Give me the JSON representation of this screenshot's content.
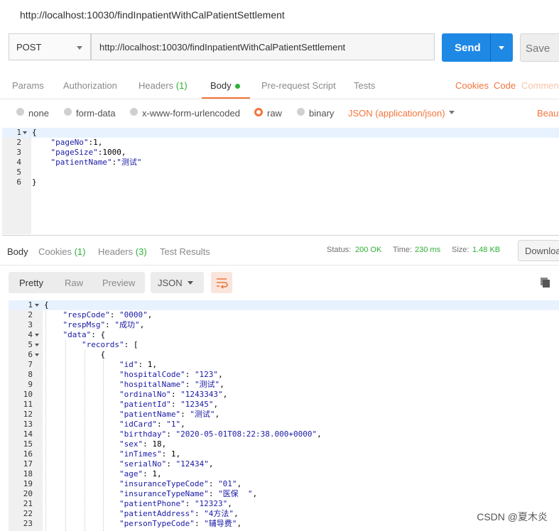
{
  "window": {
    "title": "http://localhost:10030/findInpatientWithCalPatientSettlement"
  },
  "request": {
    "method": "POST",
    "url": "http://localhost:10030/findInpatientWithCalPatientSettlement",
    "send_label": "Send",
    "save_label": "Save",
    "tabs": [
      {
        "label": "Params"
      },
      {
        "label": "Authorization"
      },
      {
        "label": "Headers",
        "count": "(1)"
      },
      {
        "label": "Body"
      },
      {
        "label": "Pre-request Script"
      },
      {
        "label": "Tests"
      }
    ],
    "right_links": {
      "cookies": "Cookies",
      "code": "Code",
      "comments": "Comments"
    },
    "body_types": [
      "none",
      "form-data",
      "x-www-form-urlencoded",
      "raw",
      "binary"
    ],
    "selected_body_type": "raw",
    "content_type": "JSON (application/json)",
    "beautify": "Beautify",
    "editor_lines": [
      {
        "n": "1",
        "t": "{"
      },
      {
        "n": "2",
        "t": "    \"pageNo\":1,"
      },
      {
        "n": "3",
        "t": "    \"pageSize\":1000,"
      },
      {
        "n": "4",
        "t": "    \"patientName\":\"测试\""
      },
      {
        "n": "5",
        "t": ""
      },
      {
        "n": "6",
        "t": "}"
      }
    ]
  },
  "response": {
    "tabs": [
      {
        "label": "Body"
      },
      {
        "label": "Cookies",
        "count": "(1)"
      },
      {
        "label": "Headers",
        "count": "(3)"
      },
      {
        "label": "Test Results"
      }
    ],
    "status_label": "Status:",
    "status_value": "200 OK",
    "time_label": "Time:",
    "time_value": "230 ms",
    "size_label": "Size:",
    "size_value": "1.48 KB",
    "download_label": "Download",
    "view_modes": [
      "Pretty",
      "Raw",
      "Preview"
    ],
    "format": "JSON",
    "lines": [
      {
        "n": "1",
        "t": "{",
        "fold": true
      },
      {
        "n": "2",
        "t": "    \"respCode\": \"0000\","
      },
      {
        "n": "3",
        "t": "    \"respMsg\": \"成功\","
      },
      {
        "n": "4",
        "t": "    \"data\": {",
        "fold": true
      },
      {
        "n": "5",
        "t": "        \"records\": [",
        "fold": true
      },
      {
        "n": "6",
        "t": "            {",
        "fold": true
      },
      {
        "n": "7",
        "t": "                \"id\": 1,"
      },
      {
        "n": "8",
        "t": "                \"hospitalCode\": \"123\","
      },
      {
        "n": "9",
        "t": "                \"hospitalName\": \"测试\","
      },
      {
        "n": "10",
        "t": "                \"ordinalNo\": \"1243343\","
      },
      {
        "n": "11",
        "t": "                \"patientId\": \"12345\","
      },
      {
        "n": "12",
        "t": "                \"patientName\": \"测试\","
      },
      {
        "n": "13",
        "t": "                \"idCard\": \"1\","
      },
      {
        "n": "14",
        "t": "                \"birthday\": \"2020-05-01T08:22:38.000+0000\","
      },
      {
        "n": "15",
        "t": "                \"sex\": 18,"
      },
      {
        "n": "16",
        "t": "                \"inTimes\": 1,"
      },
      {
        "n": "17",
        "t": "                \"serialNo\": \"12434\","
      },
      {
        "n": "18",
        "t": "                \"age\": 1,"
      },
      {
        "n": "19",
        "t": "                \"insuranceTypeCode\": \"01\","
      },
      {
        "n": "20",
        "t": "                \"insuranceTypeName\": \"医保  \","
      },
      {
        "n": "21",
        "t": "                \"patientPhone\": \"12323\","
      },
      {
        "n": "22",
        "t": "                \"patientAddress\": \"4方法\","
      },
      {
        "n": "23",
        "t": "                \"personTypeCode\": \"辅导费\","
      }
    ]
  },
  "watermark": "CSDN @夏木炎",
  "colors": {
    "accent": "#f4743b",
    "send": "#1e88e5",
    "success": "#2db036"
  }
}
